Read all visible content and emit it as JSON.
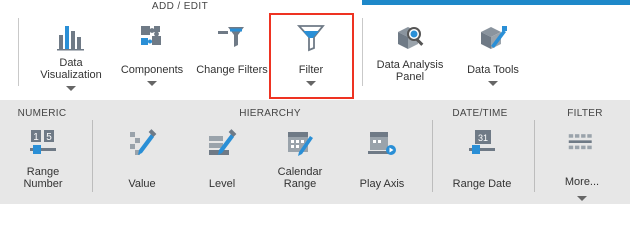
{
  "top": {
    "section_label": "ADD / EDIT",
    "buttons": [
      {
        "label": "Data Visualization",
        "icon": "bar-chart-icon"
      },
      {
        "label": "Components",
        "icon": "puzzle-pieces-icon"
      },
      {
        "label": "Change Filters",
        "icon": "change-filter-icon"
      },
      {
        "label": "Filter",
        "icon": "funnel-icon",
        "highlighted": true
      },
      {
        "label": "Data Analysis Panel",
        "icon": "magnifier-cube-icon"
      },
      {
        "label": "Data Tools",
        "icon": "cube-wrench-icon"
      }
    ]
  },
  "bottom": {
    "sections": [
      "NUMERIC",
      "HIERARCHY",
      "DATE/TIME",
      "FILTER"
    ],
    "buttons": [
      {
        "label": "Range Number",
        "icon": "range-number-icon"
      },
      {
        "label": "Value",
        "icon": "tree-value-icon"
      },
      {
        "label": "Level",
        "icon": "tree-level-icon"
      },
      {
        "label": "Calendar Range",
        "icon": "calendar-range-icon"
      },
      {
        "label": "Play Axis",
        "icon": "play-axis-icon"
      },
      {
        "label": "Range Date",
        "icon": "range-date-icon"
      },
      {
        "label": "More...",
        "icon": "filter-more-icon"
      }
    ],
    "range_number_digits": [
      "1",
      "5"
    ],
    "calendar_day": "31"
  },
  "colors": {
    "accent": "#1e88c9",
    "icon_gray": "#6f7a86",
    "icon_blue": "#2a8fd6",
    "highlight": "#e32222",
    "ribbon_bottom": "#e7e7e7"
  }
}
